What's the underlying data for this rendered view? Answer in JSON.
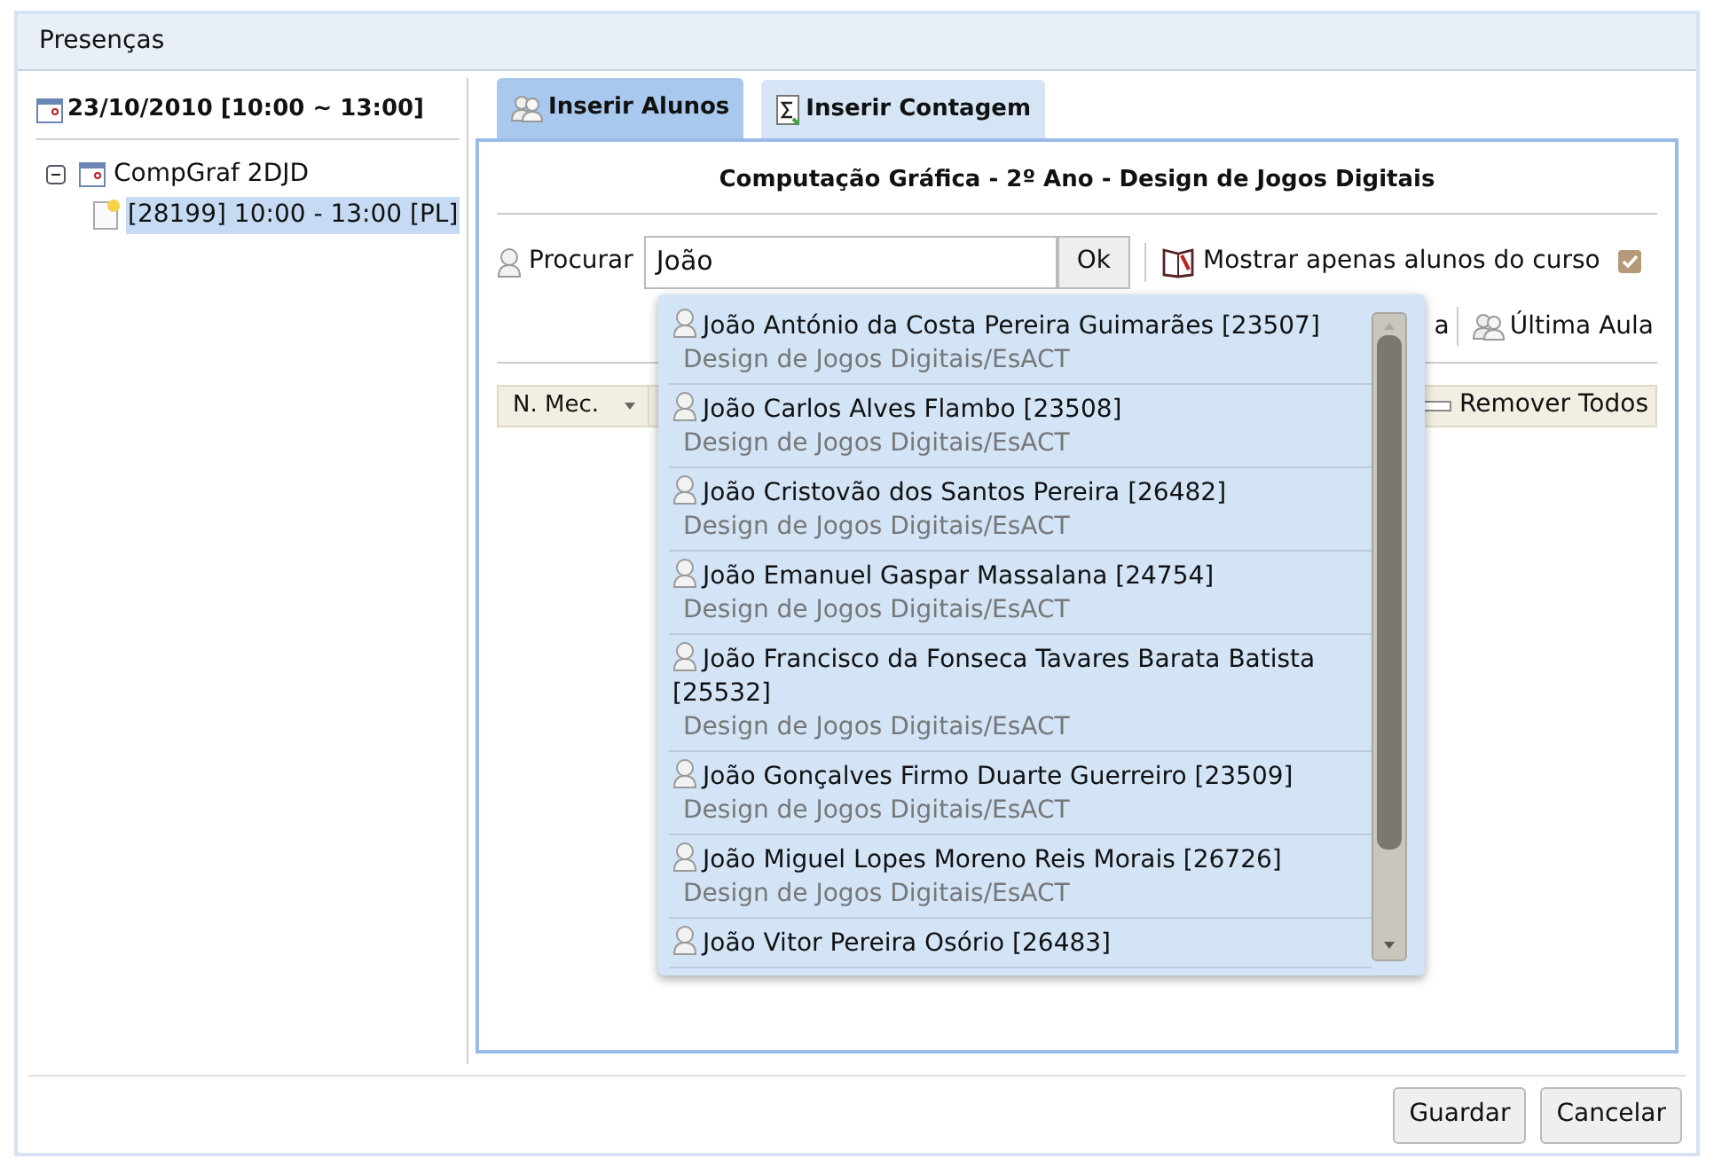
{
  "window": {
    "title": "Presenças"
  },
  "sidebar": {
    "header": "23/10/2010 [10:00 ~ 13:00]",
    "tree": [
      {
        "label": "CompGraf 2DJD",
        "expanded": true,
        "selected": false,
        "children": [
          {
            "label": "[28199] 10:00 - 13:00 [PL]",
            "selected": true
          }
        ]
      }
    ]
  },
  "tabs": [
    {
      "label": "Inserir Alunos",
      "selected": true
    },
    {
      "label": "Inserir Contagem",
      "selected": false
    }
  ],
  "panel": {
    "heading": "Computação Gráfica - 2º Ano - Design de Jogos Digitais",
    "search": {
      "label": "Procurar",
      "value": "João",
      "button": "Ok"
    },
    "filter": {
      "label": "Mostrar apenas alunos do curso",
      "checked": true
    },
    "toolbar": [
      "a",
      "Última Aula"
    ],
    "table": {
      "columns": [
        "N. Mec."
      ]
    },
    "remove_all": "Remover Todos"
  },
  "suggestions": [
    {
      "name": "João António da Costa Pereira Guimarães [23507]",
      "course": "Design de Jogos Digitais/EsACT"
    },
    {
      "name": "João Carlos Alves Flambo [23508]",
      "course": "Design de Jogos Digitais/EsACT"
    },
    {
      "name": "João Cristovão dos Santos Pereira [26482]",
      "course": "Design de Jogos Digitais/EsACT"
    },
    {
      "name": "João Emanuel Gaspar Massalana [24754]",
      "course": "Design de Jogos Digitais/EsACT"
    },
    {
      "name": "João Francisco da Fonseca Tavares Barata Batista [25532]",
      "course": "Design de Jogos Digitais/EsACT"
    },
    {
      "name": "João Gonçalves Firmo Duarte Guerreiro [23509]",
      "course": "Design de Jogos Digitais/EsACT"
    },
    {
      "name": "João Miguel Lopes Moreno Reis Morais [26726]",
      "course": "Design de Jogos Digitais/EsACT"
    },
    {
      "name": "João Vitor Pereira Osório [26483]"
    }
  ],
  "buttons": [
    "Guardar",
    "Cancelar"
  ]
}
